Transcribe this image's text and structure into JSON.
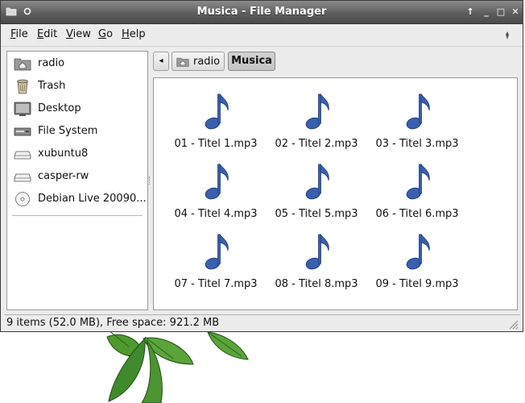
{
  "window": {
    "title": "Musica - File Manager",
    "controls": [
      {
        "name": "window-menu-icon",
        "symbol": "folder"
      },
      {
        "name": "sticky-icon",
        "symbol": "o"
      }
    ],
    "buttons": [
      {
        "name": "above-button",
        "glyph": "↑"
      },
      {
        "name": "minimize-button",
        "glyph": "_"
      },
      {
        "name": "maximize-button",
        "glyph": "□"
      },
      {
        "name": "close-button",
        "glyph": "✕"
      }
    ]
  },
  "menubar": {
    "items": [
      {
        "key": "F",
        "rest": "ile"
      },
      {
        "key": "E",
        "rest": "dit"
      },
      {
        "key": "V",
        "rest": "iew"
      },
      {
        "key": "G",
        "rest": "o"
      },
      {
        "key": "H",
        "rest": "elp"
      }
    ]
  },
  "sidebar": {
    "items": [
      {
        "label": "radio",
        "icon": "home-folder-icon"
      },
      {
        "label": "Trash",
        "icon": "trash-icon"
      },
      {
        "label": "Desktop",
        "icon": "desktop-icon"
      },
      {
        "label": "File System",
        "icon": "filesystem-icon"
      },
      {
        "label": "xubuntu8",
        "icon": "drive-icon"
      },
      {
        "label": "casper-rw",
        "icon": "drive-icon"
      },
      {
        "label": "Debian Live 20090...",
        "icon": "cdrom-icon"
      }
    ]
  },
  "pathbar": {
    "back_symbol": "◂",
    "crumbs": [
      "radio",
      "Musica"
    ]
  },
  "files": [
    "01 - Titel 1.mp3",
    "02 - Titel 2.mp3",
    "03 - Titel 3.mp3",
    "04 - Titel 4.mp3",
    "05 - Titel 5.mp3",
    "06 - Titel 6.mp3",
    "07 - Titel 7.mp3",
    "08 - Titel 8.mp3",
    "09 - Titel 9.mp3"
  ],
  "status": {
    "text": "9 items (52.0 MB), Free space: 921.2 MB"
  },
  "colors": {
    "titlebar": "#5e5e5e",
    "note_icon": "#3a5fae",
    "leaf": "#3f8a2a"
  }
}
